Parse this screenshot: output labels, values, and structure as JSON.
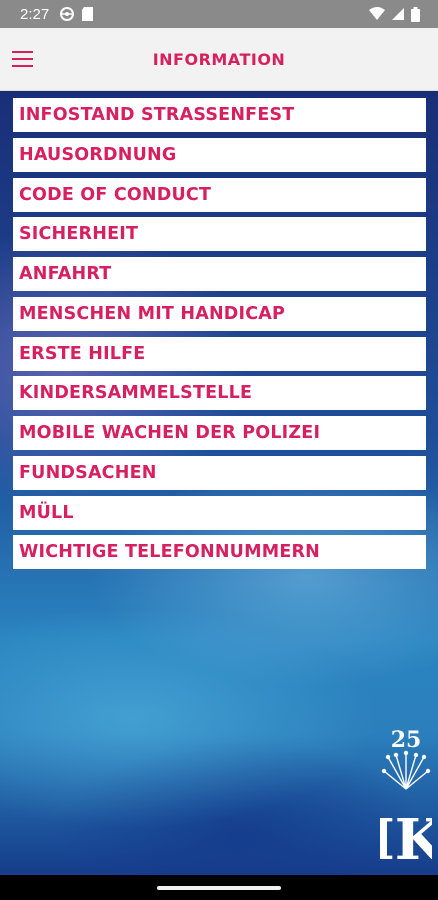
{
  "status_bar": {
    "time": "2:27",
    "left_icons": [
      "settings-globe-icon",
      "sd-card-icon"
    ],
    "right_icons": [
      "wifi-icon",
      "signal-icon",
      "battery-icon"
    ]
  },
  "app_bar": {
    "title": "INFORMATION",
    "menu_icon": "hamburger-menu-icon",
    "accent_color": "#d6215e"
  },
  "menu": {
    "items": [
      {
        "label": "INFOSTAND STRASSENFEST"
      },
      {
        "label": "HAUSORDNUNG"
      },
      {
        "label": "CODE OF CONDUCT"
      },
      {
        "label": "SICHERHEIT"
      },
      {
        "label": "ANFAHRT"
      },
      {
        "label": "MENSCHEN MIT HANDICAP"
      },
      {
        "label": "ERSTE HILFE"
      },
      {
        "label": "KINDERSAMMELSTELLE"
      },
      {
        "label": "MOBILE WACHEN DER POLIZEI"
      },
      {
        "label": "FUNDSACHEN"
      },
      {
        "label": "MÜLL"
      },
      {
        "label": "WICHTIGE TELEFONNUMMERN"
      }
    ]
  },
  "logo": {
    "number": "25",
    "letters": "IK"
  }
}
